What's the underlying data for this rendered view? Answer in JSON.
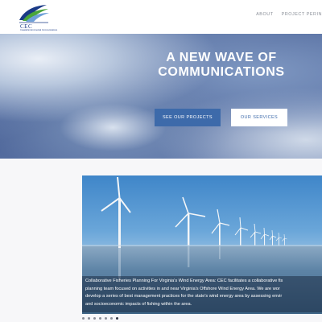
{
  "header": {
    "logo_text": "CEC",
    "logo_subtext": "Coastal Environmental Communications",
    "nav": [
      {
        "label": "ABOUT"
      },
      {
        "label": "PROJECT PERIN"
      }
    ]
  },
  "hero": {
    "title_line1": "A NEW WAVE OF",
    "title_line2": "COMMUNICATIONS",
    "primary_button": "SEE OUR PROJECTS",
    "secondary_button": "OUR SERVICES"
  },
  "slide": {
    "caption_lines": [
      "Collaborative Fisheries Planning For Virginia's Wind Energy Area: CEC facilitates a collaborative fis",
      "planning team focused on activities in and near Virginia's Offshore Wind Energy Area. We are wor",
      "develop a series of best management practices for the state's wind energy area by assessing envir",
      "and socioeconomic impacts of fishing within the area."
    ]
  },
  "carousel": {
    "dot_count": 7,
    "active_index": 6
  },
  "colors": {
    "accent_blue": "#3d6aaa",
    "logo_blue": "#1a3a86",
    "logo_green": "#4aa63a"
  }
}
